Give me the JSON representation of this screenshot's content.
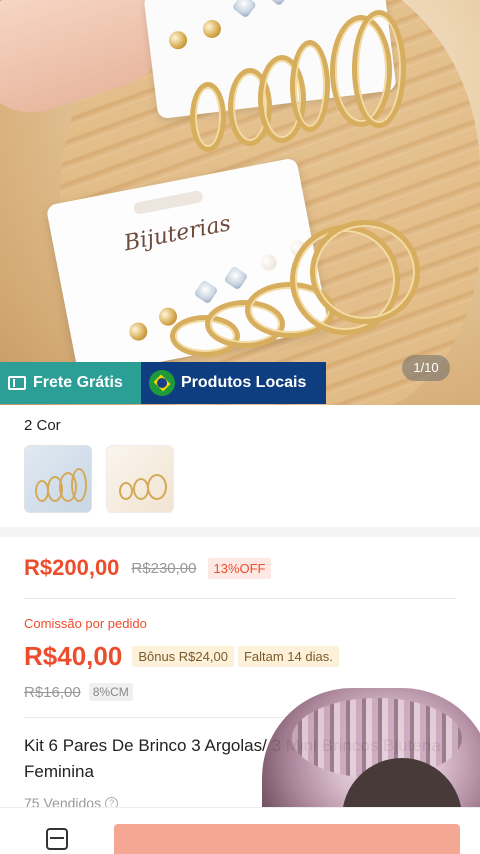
{
  "hero": {
    "card_brand": "Bijuterias",
    "counter": "1/10"
  },
  "badges": {
    "free_shipping": "Frete Grátis",
    "local_products": "Produtos Locais"
  },
  "variants": {
    "title": "2 Cor"
  },
  "price": {
    "current": "R$200,00",
    "original": "R$230,00",
    "discount": "13%OFF"
  },
  "commission": {
    "label": "Comissão por pedido",
    "value": "R$40,00",
    "bonus": "Bônus R$24,00",
    "remaining": "Faltam 14 dias.",
    "old_value": "R$16,00",
    "rate": "8%CM"
  },
  "product": {
    "title": "Kit 6 Pares De Brinco 3 Argolas/ 3 Mini Brincos Bjuteria Feminina",
    "sold": "75 Vendidos"
  },
  "colors": {
    "accent": "#ee4d2d",
    "teal": "#2b9f95",
    "navy": "#0e3e7f"
  }
}
